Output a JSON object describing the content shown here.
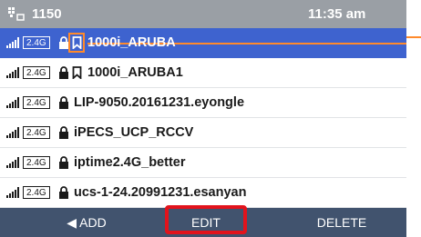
{
  "status_bar": {
    "extension": "1150",
    "time": "11:35 am",
    "background": "#9a9fa5"
  },
  "networks": [
    {
      "band": "2.4G",
      "ssid": "1000i_ARUBA",
      "locked": true,
      "bookmarked": true,
      "selected": true
    },
    {
      "band": "2.4G",
      "ssid": "1000i_ARUBA1",
      "locked": true,
      "bookmarked": true,
      "selected": false
    },
    {
      "band": "2.4G",
      "ssid": "LIP-9050.20161231.eyongle",
      "locked": true,
      "bookmarked": false,
      "selected": false
    },
    {
      "band": "2.4G",
      "ssid": "iPECS_UCP_RCCV",
      "locked": true,
      "bookmarked": false,
      "selected": false
    },
    {
      "band": "2.4G",
      "ssid": "iptime2.4G_better",
      "locked": true,
      "bookmarked": false,
      "selected": false
    },
    {
      "band": "2.4G",
      "ssid": "ucs-1-24.20991231.esanyan",
      "locked": true,
      "bookmarked": false,
      "selected": false
    }
  ],
  "actions": {
    "add": "◀ ADD",
    "edit": "EDIT",
    "delete": "DELETE"
  },
  "colors": {
    "selected_row": "#3e63cf",
    "action_bar": "#41536e",
    "highlight_red": "#e2131c",
    "callout_orange": "#ff8a2b"
  },
  "icons": [
    "extension-phone-icon",
    "wifi-signal-icon",
    "lock-icon",
    "bookmark-icon"
  ]
}
